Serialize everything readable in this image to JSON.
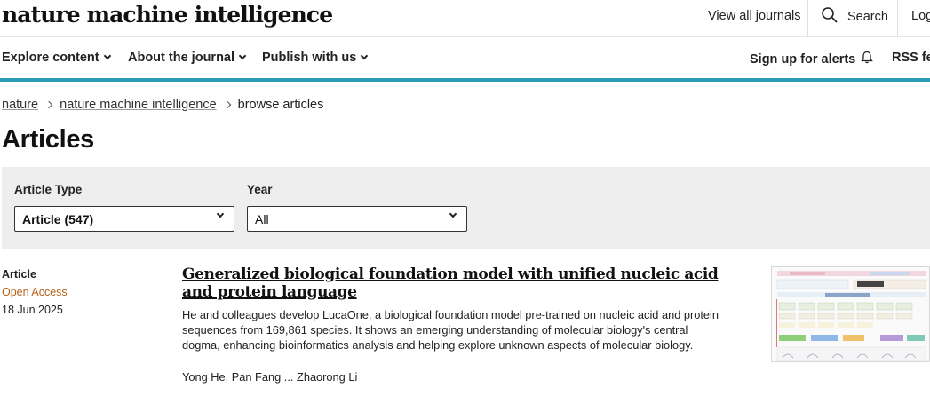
{
  "header": {
    "logo_text": "nature machine intelligence",
    "view_all_journals": "View all journals",
    "search_label": "Search",
    "login_label": "Log"
  },
  "nav": {
    "explore": "Explore content",
    "about": "About the journal",
    "publish": "Publish with us",
    "alerts": "Sign up for alerts",
    "rss": "RSS fe"
  },
  "breadcrumb": {
    "items": [
      "nature",
      "nature machine intelligence"
    ],
    "current": "browse articles"
  },
  "page_title": "Articles",
  "filters": {
    "article_type_label": "Article Type",
    "article_type_value": "Article (547)",
    "year_label": "Year",
    "year_value": "All"
  },
  "article": {
    "type": "Article",
    "access": "Open Access",
    "date": "18 Jun 2025",
    "title": "Generalized biological foundation model with unified nucleic acid and protein language",
    "summary": "He and colleagues develop LucaOne, a biological foundation model pre-trained on nucleic acid and protein sequences from 169,861 species. It shows an emerging understanding of molecular biology's central dogma, enhancing bioinformatics analysis and helping explore unknown aspects of molecular biology.",
    "authors": "Yong He, Pan Fang ... Zhaorong Li"
  },
  "colors": {
    "accent_bar": "#2b9bb3",
    "open_access": "#b5621a",
    "filter_bg": "#eeeeee"
  }
}
